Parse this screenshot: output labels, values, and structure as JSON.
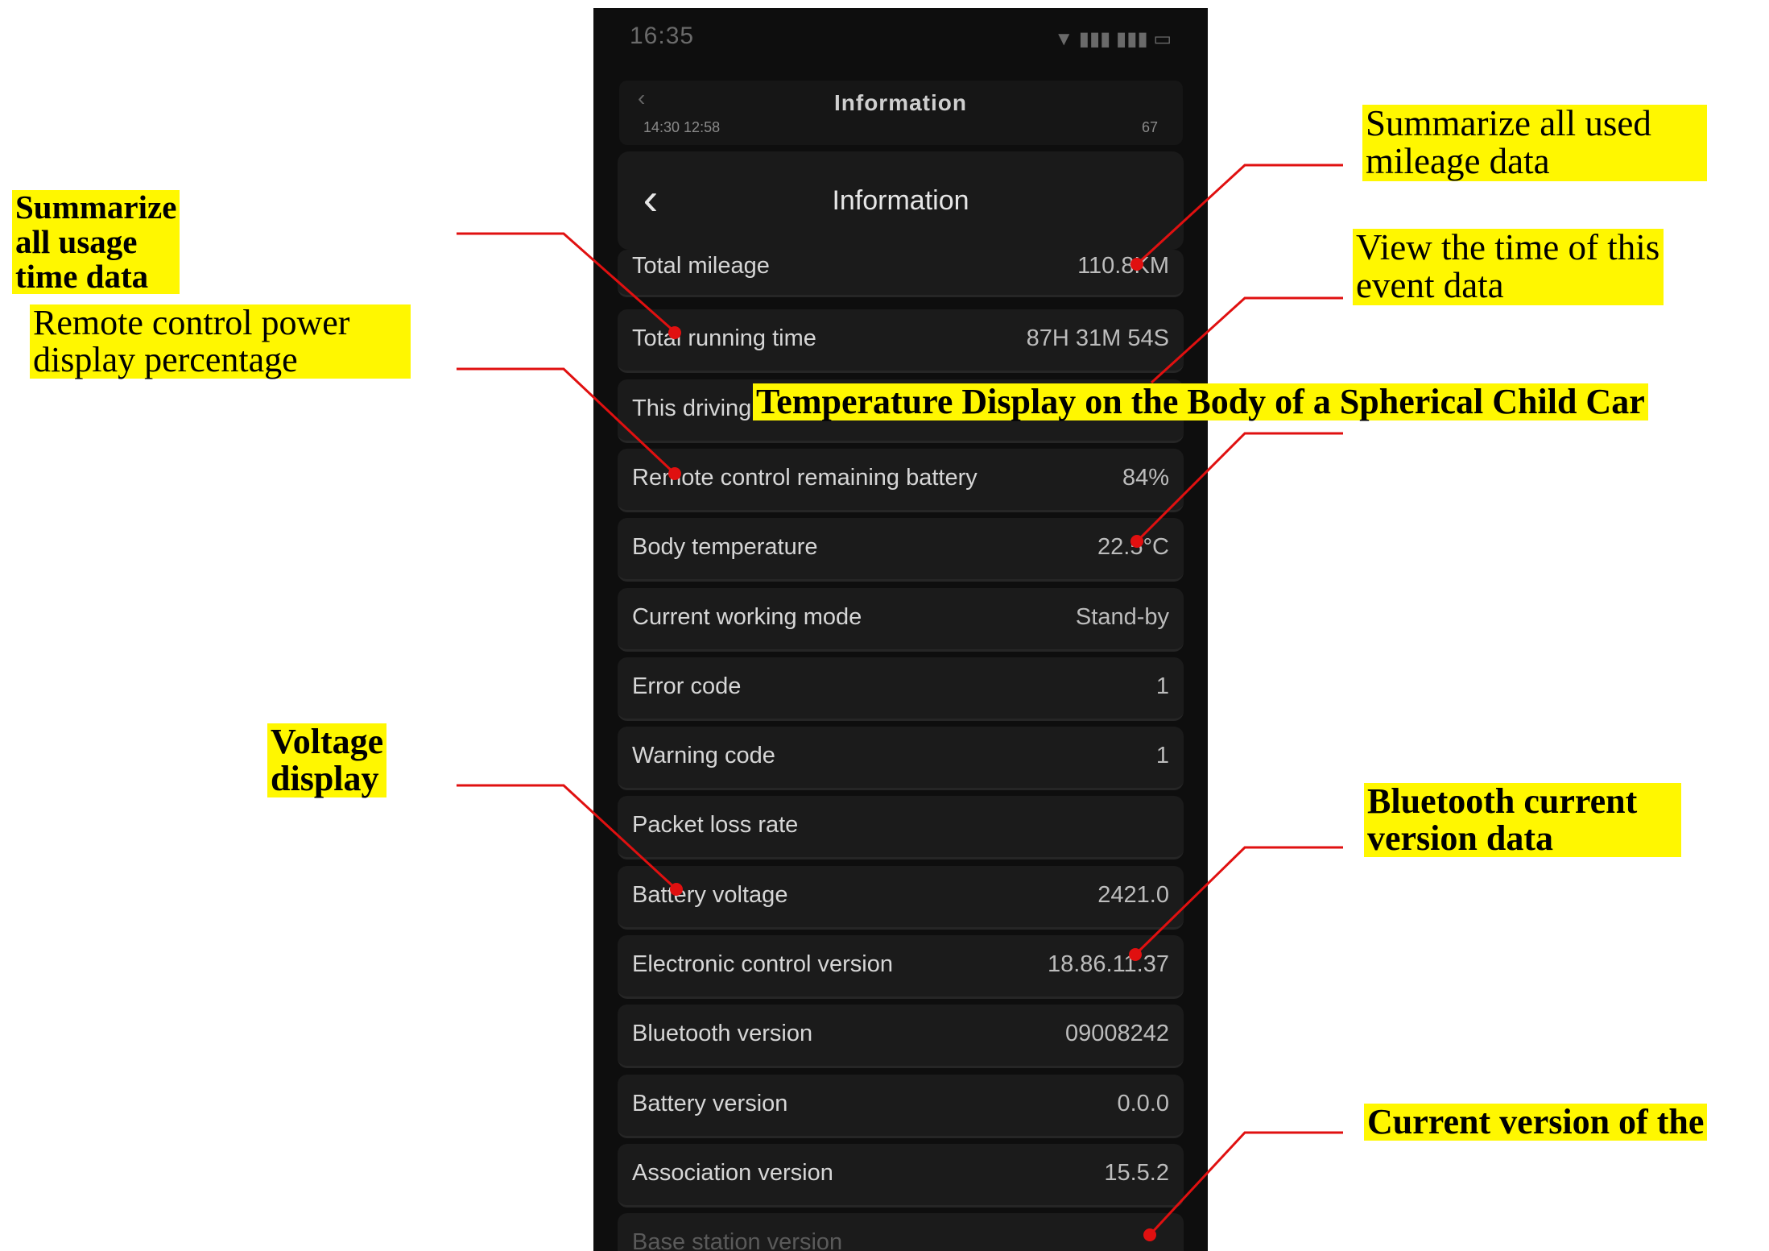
{
  "status_bar": {
    "time": "16:35",
    "icons": "signal-wifi-battery"
  },
  "ghost_header": {
    "title": "Information",
    "status_left": "14:30 12:58",
    "status_right": "67"
  },
  "header": {
    "back_icon": "chevron-left-icon",
    "title": "Information"
  },
  "rows": [
    {
      "label": "Total mileage",
      "value": "110.8KM"
    },
    {
      "label": "Total running time",
      "value": "87H 31M 54S"
    },
    {
      "label": "This driving time",
      "value": ""
    },
    {
      "label": "Remote control remaining battery",
      "value": "84%"
    },
    {
      "label": "Body temperature",
      "value": "22.5°C"
    },
    {
      "label": "Current working mode",
      "value": "Stand-by"
    },
    {
      "label": "Error code",
      "value": "1"
    },
    {
      "label": "Warning code",
      "value": "1"
    },
    {
      "label": "Packet loss rate",
      "value": ""
    },
    {
      "label": "Battery voltage",
      "value": "2421.0"
    },
    {
      "label": "Electronic control version",
      "value": "18.86.11.37"
    },
    {
      "label": "Bluetooth version",
      "value": "09008242"
    },
    {
      "label": "Battery version",
      "value": "0.0.0"
    },
    {
      "label": "Association version",
      "value": "15.5.2"
    },
    {
      "label": "Base station version",
      "value": ""
    }
  ],
  "callouts": {
    "usage_time": "Summarize all usage time data",
    "remote_power": "Remote control power display percentage",
    "voltage": "Voltage display",
    "mileage": "Summarize all used mileage data",
    "event_time": "View the time of this event data",
    "temperature": "Temperature Display on the Body of a Spherical Child Car",
    "bluetooth": "Bluetooth current version data",
    "current_version": "Current version of the"
  },
  "colors": {
    "callout_bg": "#fff700",
    "leader_line": "#e01010",
    "screen_bg": "#0e0e0e",
    "row_bg": "#1b1b1b"
  }
}
